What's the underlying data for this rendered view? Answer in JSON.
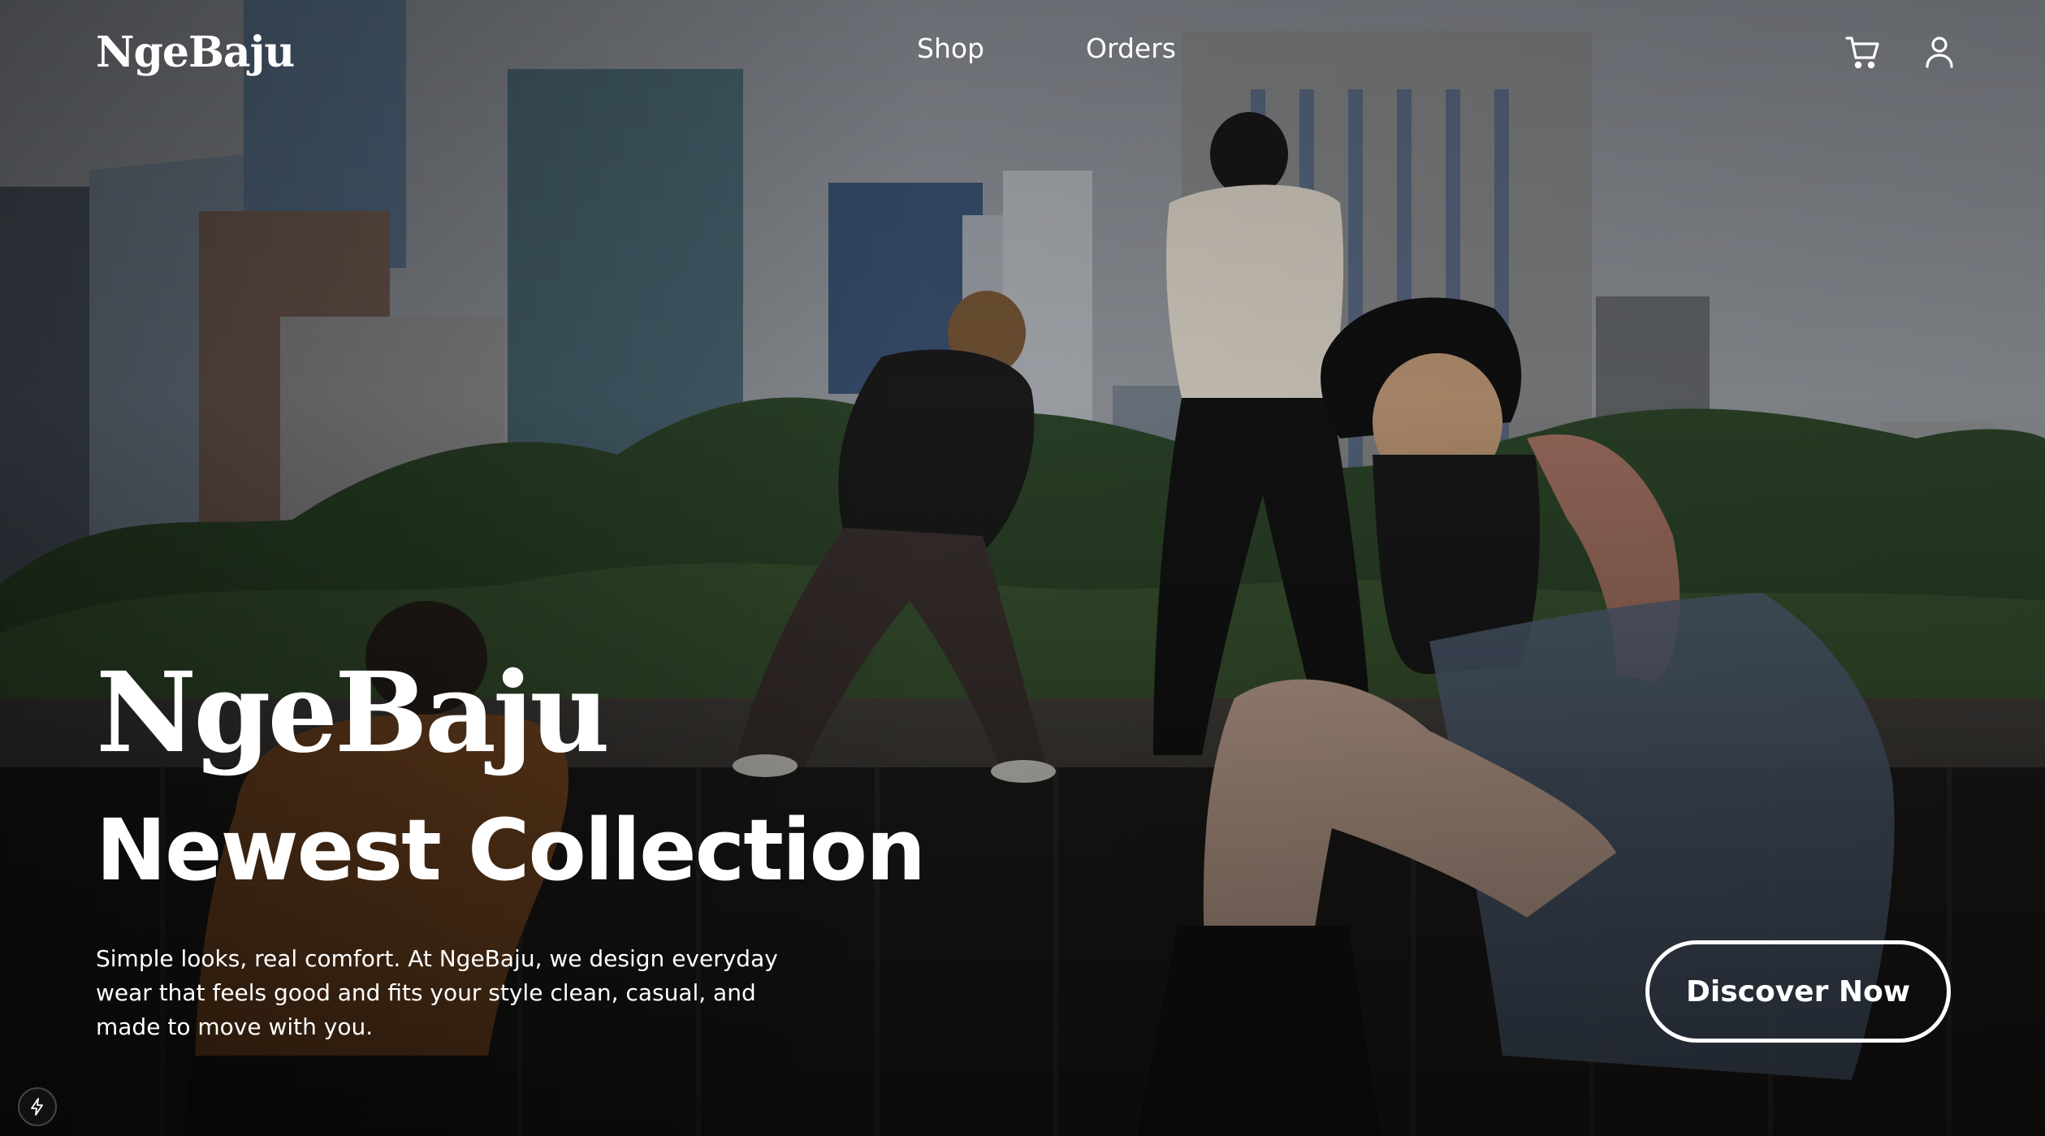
{
  "nav": {
    "logo": "NgeBaju",
    "links": [
      {
        "label": "Shop"
      },
      {
        "label": "Orders"
      }
    ],
    "icons": [
      "cart-icon",
      "user-icon"
    ]
  },
  "hero": {
    "brand": "NgeBaju",
    "title": "Newest Collection",
    "description": "Simple looks, real comfort. At NgeBaju, we design everyday wear that feels good and fits your style clean, casual, and made to move with you.",
    "cta_label": "Discover Now",
    "background": "photo of four models posing on a wooden deck with city skyscrapers and trees behind",
    "colors": {
      "text": "#ffffff",
      "overlay": "#000000"
    }
  },
  "badge": {
    "icon": "lightning-icon"
  }
}
